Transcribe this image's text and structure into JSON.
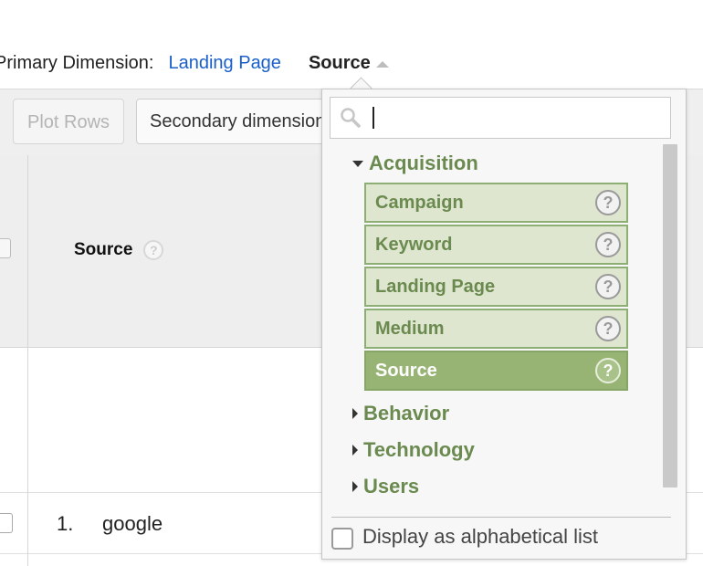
{
  "primary_dimension": {
    "label": "Primary Dimension:",
    "options": [
      "Landing Page",
      "Source"
    ],
    "active": "Source"
  },
  "toolbar": {
    "plot_rows_label": "Plot Rows",
    "secondary_dimension_label": "Secondary dimension"
  },
  "table": {
    "header_source_label": "Source",
    "rows": [
      {
        "index": "1.",
        "value": "google"
      }
    ]
  },
  "dropdown": {
    "search_placeholder": "",
    "groups": [
      {
        "label": "Acquisition",
        "expanded": true,
        "items": [
          {
            "label": "Campaign",
            "selected": false
          },
          {
            "label": "Keyword",
            "selected": false
          },
          {
            "label": "Landing Page",
            "selected": false
          },
          {
            "label": "Medium",
            "selected": false
          },
          {
            "label": "Source",
            "selected": true
          }
        ]
      },
      {
        "label": "Behavior",
        "expanded": false
      },
      {
        "label": "Technology",
        "expanded": false
      },
      {
        "label": "Users",
        "expanded": false
      }
    ],
    "alphabetical_label": "Display as alphabetical list",
    "help_glyph": "?"
  },
  "colors": {
    "link": "#1a5fc9",
    "group_text": "#6a8a4f",
    "item_bg": "#dfe6cf",
    "item_selected_bg": "#98b474"
  },
  "icons": {
    "search": "search-icon",
    "help": "help-icon",
    "expand": "triangle-down-icon",
    "collapse": "triangle-right-icon"
  }
}
